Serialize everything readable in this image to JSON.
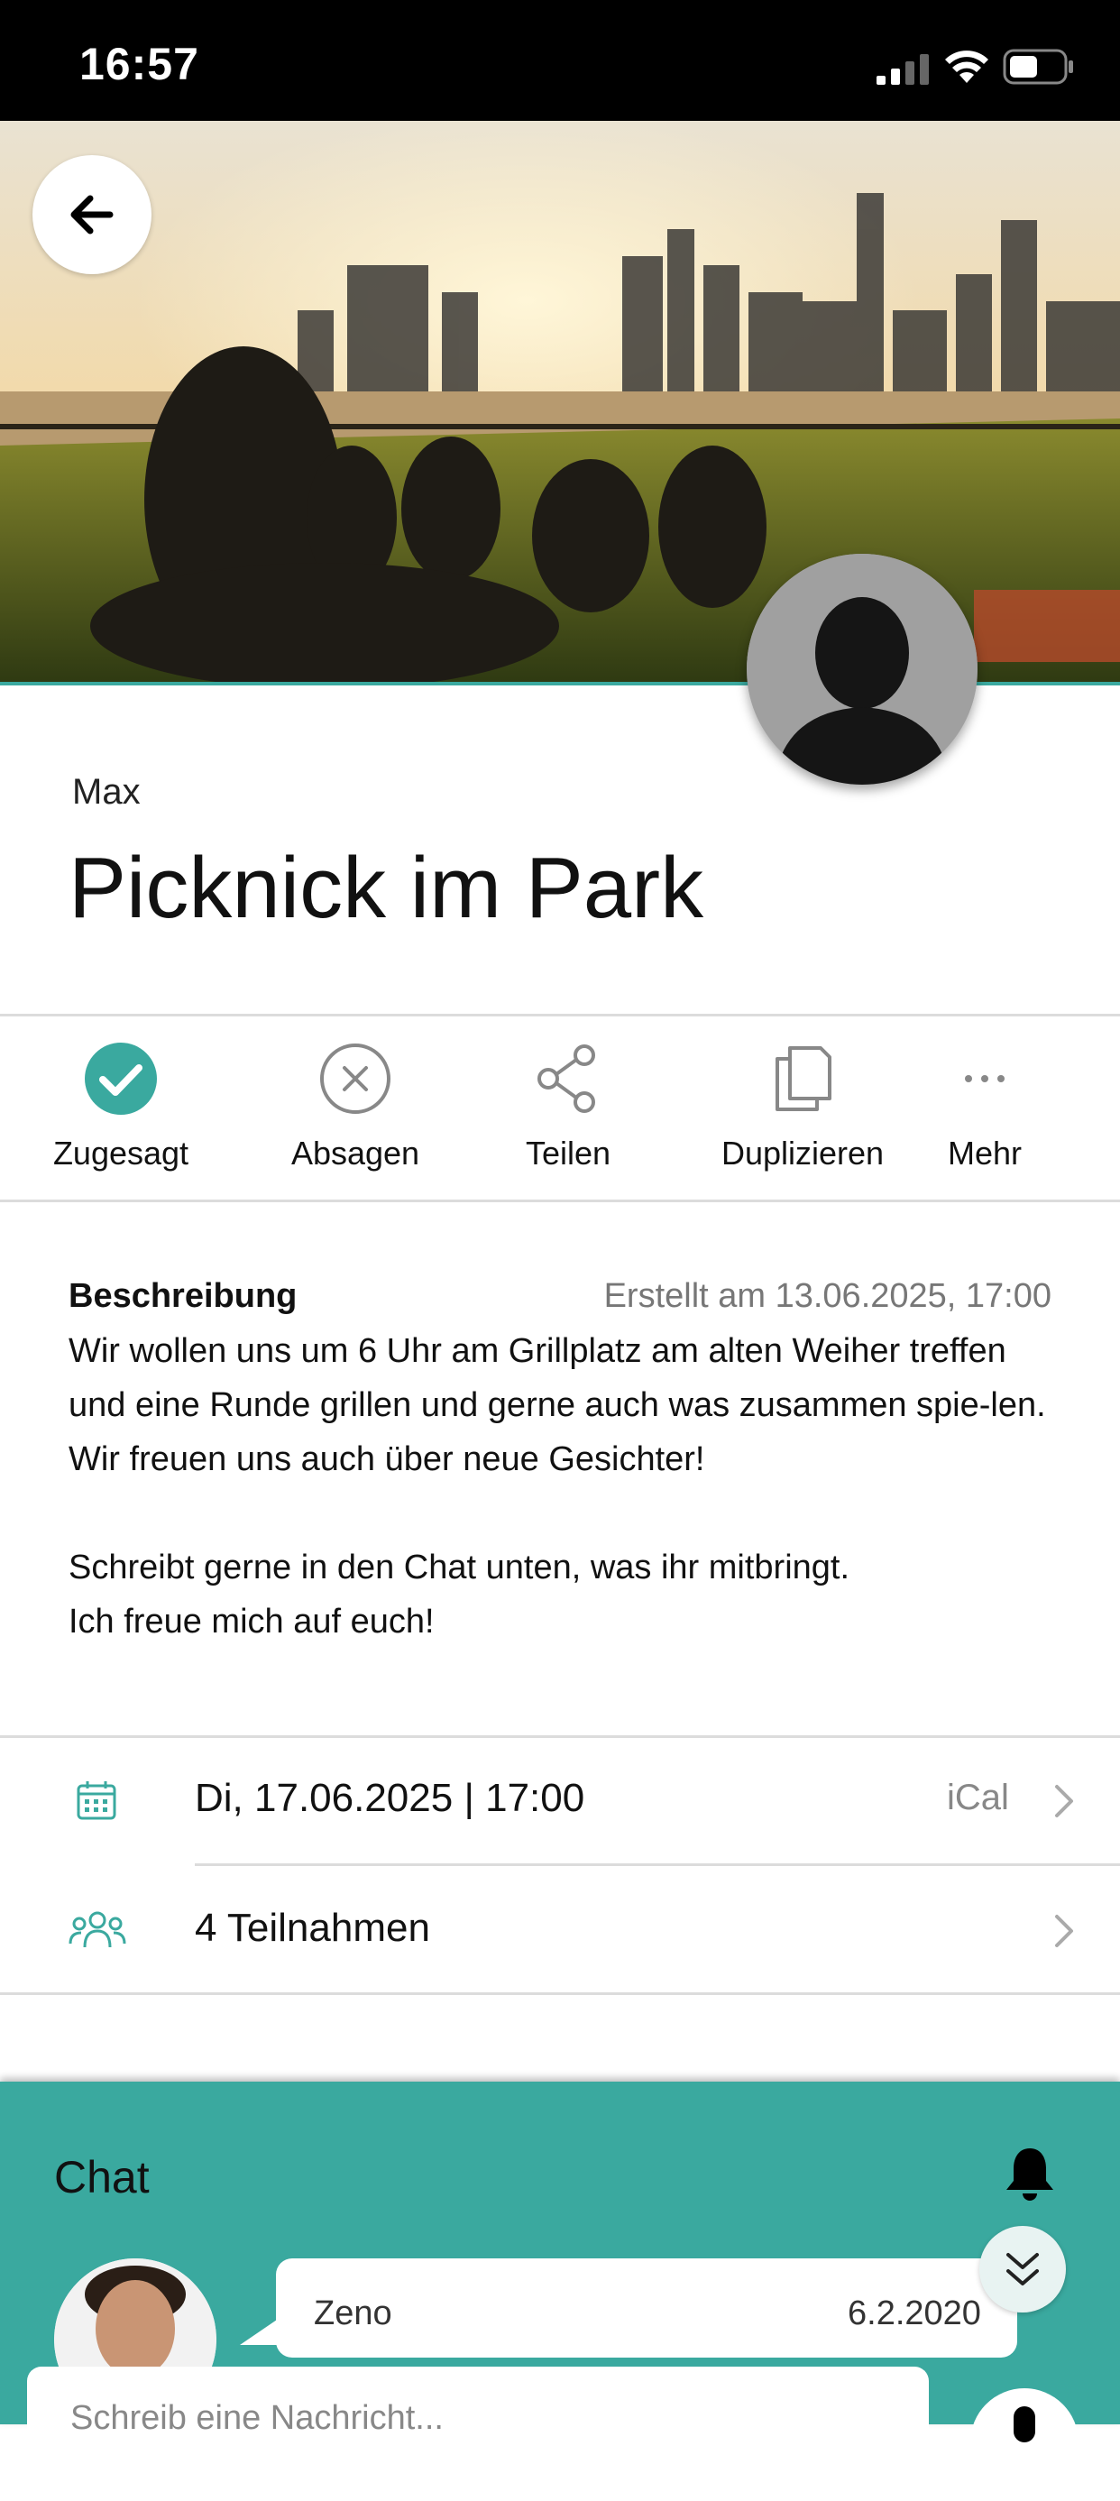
{
  "status_bar": {
    "time": "16:57"
  },
  "event": {
    "organizer": "Max",
    "title": "Picknick im Park"
  },
  "actions": [
    {
      "label": "Zugesagt",
      "icon": "check-circle-icon"
    },
    {
      "label": "Absagen",
      "icon": "x-circle-icon"
    },
    {
      "label": "Teilen",
      "icon": "share-icon"
    },
    {
      "label": "Duplizieren",
      "icon": "copy-icon"
    },
    {
      "label": "Mehr",
      "icon": "more-icon"
    }
  ],
  "description": {
    "heading": "Beschreibung",
    "created": "Erstellt am 13.06.2025, 17:00",
    "text": "Wir wollen uns um 6 Uhr am Grillplatz am alten Weiher treffen und eine Runde grillen und gerne auch was zusammen spie-len. Wir freuen uns auch über neue Gesichter!\n\nSchreibt gerne in den Chat unten, was ihr mitbringt.\nIch freue mich auf euch!"
  },
  "details": {
    "date": "Di, 17.06.2025 | 17:00",
    "ical": "iCal",
    "participants": "4 Teilnahmen"
  },
  "chat": {
    "title": "Chat",
    "message": {
      "sender": "Zeno",
      "date": "6.2.2020"
    },
    "input_placeholder": "Schreib eine Nachricht..."
  },
  "colors": {
    "accent": "#3aa99f",
    "divider": "#dcdcdc"
  }
}
